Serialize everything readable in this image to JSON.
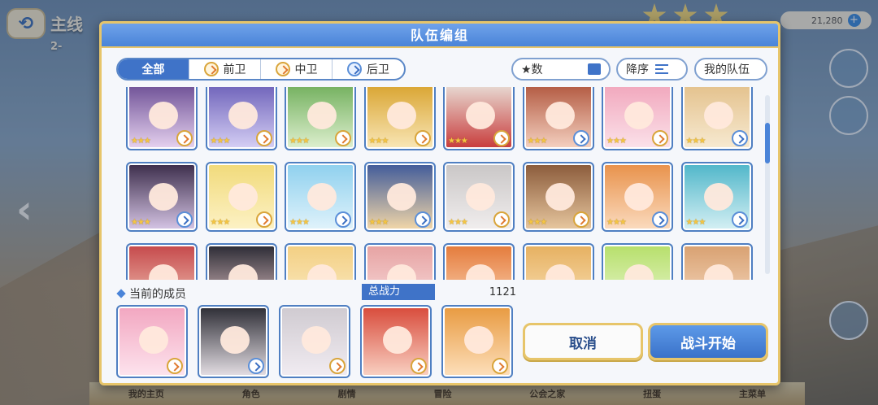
{
  "background": {
    "title": "主线",
    "subtitle": "2-",
    "currency_value": "21,280",
    "bottom_nav": [
      "我的主页",
      "角色",
      "剧情",
      "冒险",
      "公会之家",
      "扭蛋",
      "主菜单"
    ]
  },
  "dialog": {
    "title": "队伍编组",
    "filters": {
      "all_label": "全部",
      "front_label": "前卫",
      "middle_label": "中卫",
      "back_label": "后卫"
    },
    "star_sort_label": "★数",
    "order_label": "降序",
    "my_team_label": "我的队伍",
    "members_label": "当前的成员",
    "power_label": "总战力",
    "power_value": "1121",
    "cancel_label": "取消",
    "start_label": "战斗开始"
  },
  "roster": [
    {
      "colors": [
        "#6a4c93",
        "#e7d3f0"
      ],
      "stars": "★★★",
      "role": "front"
    },
    {
      "colors": [
        "#6b5fb8",
        "#d6d0f5"
      ],
      "stars": "★★★",
      "role": "middle"
    },
    {
      "colors": [
        "#6fae5a",
        "#dff0d0"
      ],
      "stars": "★★★",
      "role": "front"
    },
    {
      "colors": [
        "#d8a22c",
        "#f9e7b8"
      ],
      "stars": "★★★",
      "role": "front"
    },
    {
      "colors": [
        "#e9e2da",
        "#c83a3a"
      ],
      "stars": "★★★",
      "role": "front"
    },
    {
      "colors": [
        "#b0553c",
        "#f5d2c2"
      ],
      "stars": "★★★",
      "role": "back"
    },
    {
      "colors": [
        "#f1a5bb",
        "#fbe2ea"
      ],
      "stars": "★★★",
      "role": "front"
    },
    {
      "colors": [
        "#e3c08a",
        "#f7ead2"
      ],
      "stars": "★★★",
      "role": "back"
    },
    {
      "colors": [
        "#3b2c4a",
        "#d7c6e6"
      ],
      "stars": "★★★",
      "role": "back"
    },
    {
      "colors": [
        "#f1da7a",
        "#fdf2c6"
      ],
      "stars": "★★★",
      "role": "front"
    },
    {
      "colors": [
        "#8ed0ee",
        "#e1f3fb"
      ],
      "stars": "★★★",
      "role": "back"
    },
    {
      "colors": [
        "#3f5a9a",
        "#f4d8a8"
      ],
      "stars": "★★★",
      "role": "back"
    },
    {
      "colors": [
        "#c9c6c6",
        "#f1eeee"
      ],
      "stars": "★★★",
      "role": "front"
    },
    {
      "colors": [
        "#8a5a3a",
        "#e8c8a0"
      ],
      "stars": "★★★",
      "role": "front"
    },
    {
      "colors": [
        "#e8914a",
        "#fbdcc0"
      ],
      "stars": "★★★",
      "role": "back"
    },
    {
      "colors": [
        "#4fb6c9",
        "#d6f0f4"
      ],
      "stars": "★★★",
      "role": "back"
    },
    {
      "colors": [
        "#c5484a",
        "#f2c8b8"
      ],
      "stars": "",
      "role": ""
    },
    {
      "colors": [
        "#2a2a34",
        "#e8c8c8"
      ],
      "stars": "",
      "role": ""
    },
    {
      "colors": [
        "#f3cf82",
        "#fbecc8"
      ],
      "stars": "",
      "role": ""
    },
    {
      "colors": [
        "#e6a2a2",
        "#f9dede"
      ],
      "stars": "",
      "role": ""
    },
    {
      "colors": [
        "#e47a3a",
        "#fcd7b8"
      ],
      "stars": "",
      "role": ""
    },
    {
      "colors": [
        "#e6b060",
        "#fae2b8"
      ],
      "stars": "",
      "role": ""
    },
    {
      "colors": [
        "#b6df6a",
        "#eaf7d2"
      ],
      "stars": "",
      "role": ""
    },
    {
      "colors": [
        "#d8a070",
        "#f7dcc4"
      ],
      "stars": "",
      "role": ""
    }
  ],
  "members": [
    {
      "colors": [
        "#f2a6c0",
        "#fde4ee"
      ],
      "role": "front"
    },
    {
      "colors": [
        "#2c2c34",
        "#e6e0e6"
      ],
      "role": "back"
    },
    {
      "colors": [
        "#cfcad0",
        "#f1ecf2"
      ],
      "role": "front"
    },
    {
      "colors": [
        "#d84a3a",
        "#f9d2c4"
      ],
      "role": "front"
    },
    {
      "colors": [
        "#e89a40",
        "#fde0bc"
      ],
      "role": "front"
    }
  ],
  "colors": {
    "header_blue": "#4a84d8",
    "accent_gold": "#e7c56a",
    "active_tab": "#3f73c8"
  }
}
